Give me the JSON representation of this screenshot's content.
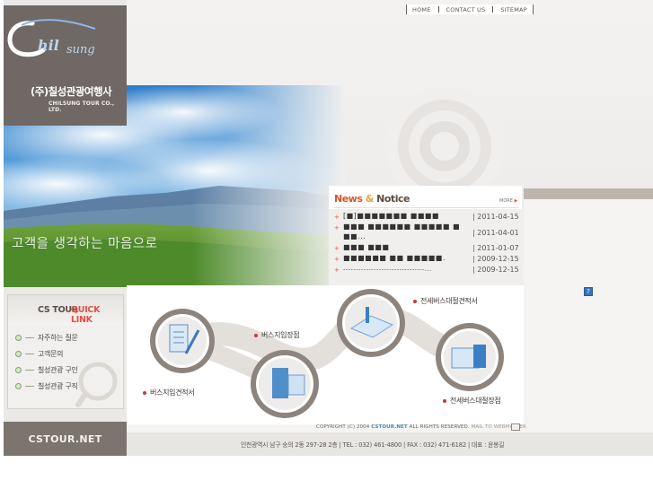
{
  "nav": {
    "home": "HOME",
    "contact": "CONTACT US",
    "sitemap": "SITEMAP"
  },
  "brand": {
    "logo_text": "Chil sung",
    "company_kr": "(주)칠성관광여행사",
    "company_en": "CHILSUNG TOUR CO., LTD."
  },
  "hero": {
    "slogan": "고객을 생각하는 마음으로"
  },
  "quick_link": {
    "title_a": "CS TOUR",
    "title_b": "QUICK LINK",
    "items": [
      "자주하는 질문",
      "고객문의",
      "칠성관광 구인",
      "칠성관광 구직"
    ]
  },
  "left_footer": {
    "label": "CSTOUR.NET"
  },
  "news": {
    "title_news": "News",
    "title_amp": "&",
    "title_notice": "Notice",
    "more": "MORE",
    "items": [
      {
        "title": "[■]■■■■■■■ ■■■■",
        "date": "| 2011-04-15"
      },
      {
        "title": "■■■ ■■■■■■ ■■■■■ ■",
        "date": "| 2011-04-01"
      },
      {
        "title": "■■...",
        "date": ""
      },
      {
        "title": "■■■ ■■■",
        "date": "| 2011-01-07"
      },
      {
        "title": "■■■■■■ ■■ ■■■■■.",
        "date": "| 2009-12-15"
      },
      {
        "title": "--------------------------------...",
        "date": "| 2009-12-15"
      }
    ]
  },
  "process": {
    "steps": [
      "버스지입견적서",
      "버스지입장점",
      "전세버스대절견적서",
      "전세버스대절장점"
    ]
  },
  "footer": {
    "copyright": "COPYRIGHT (C) 2004",
    "domain": "CSTOUR.NET",
    "rights": "ALL RIGHTS RESERVED.",
    "mail": "MAIL TO WEBMASTER",
    "address": "인천광역시 남구 숭의 2동 297-28 2층  |  TEL : 032) 461-4800  |  FAX : 032) 471-6182  |  대표 : 윤봉길"
  },
  "colors": {
    "brand_brown": "#6f6864",
    "accent_red": "#d9542c",
    "accent_orange": "#e8a23a",
    "link_blue": "#3a73b8"
  }
}
